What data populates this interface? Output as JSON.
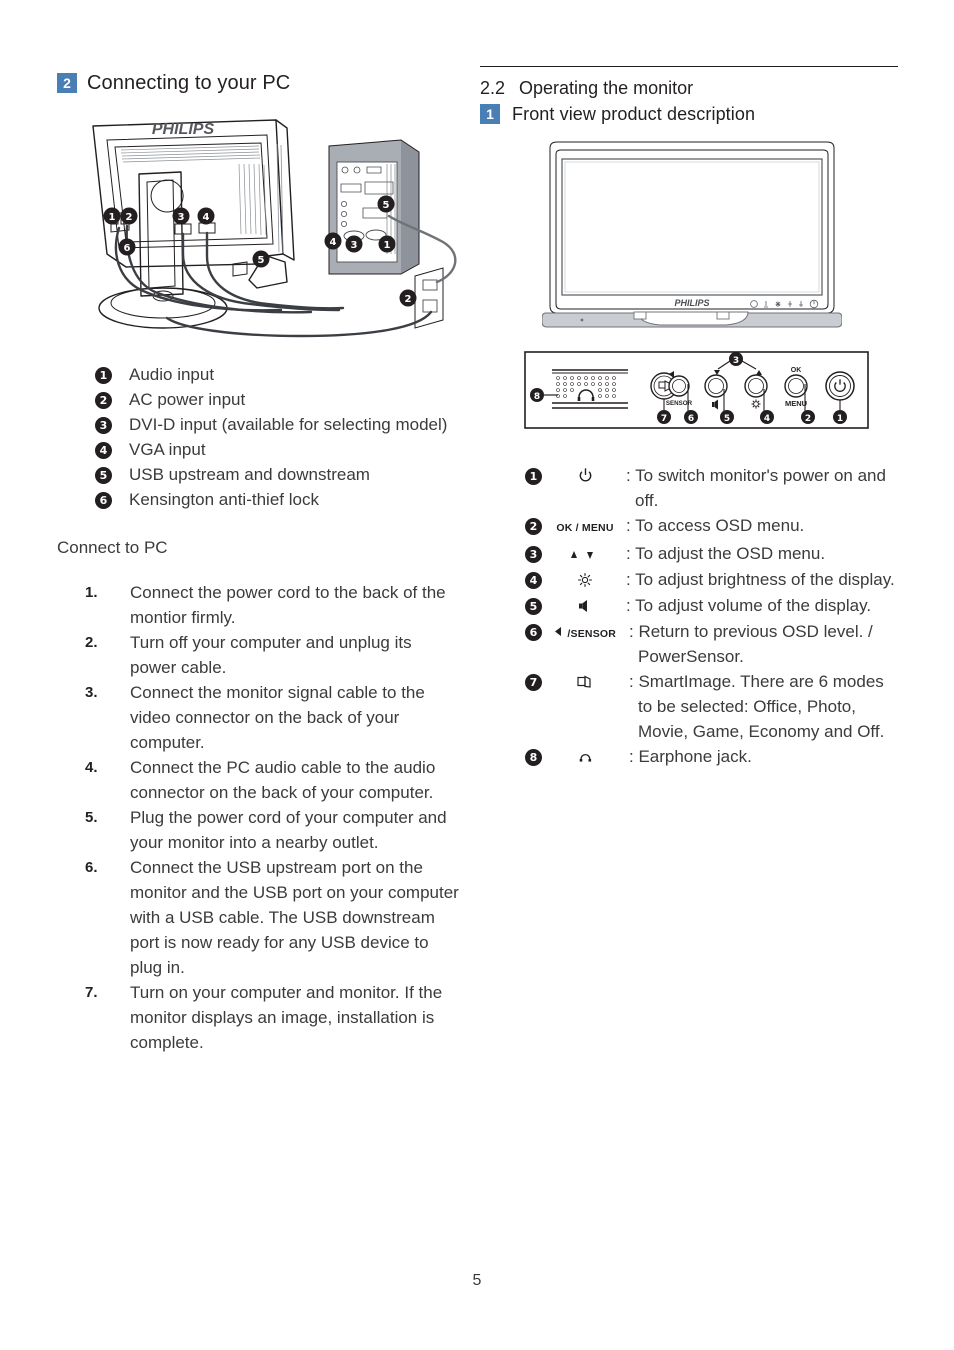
{
  "page_number": "5",
  "left_column": {
    "section_badge": "2",
    "section_title": "Connecting to your PC",
    "diagram": {
      "brand": "PHILIPS",
      "callouts": [
        "1",
        "2",
        "3",
        "4",
        "5",
        "6"
      ]
    },
    "legend": [
      {
        "num": "1",
        "label": "Audio input"
      },
      {
        "num": "2",
        "label": "AC power input"
      },
      {
        "num": "3",
        "label": "DVI-D input (available for selecting model)"
      },
      {
        "num": "4",
        "label": "VGA input"
      },
      {
        "num": "5",
        "label": "USB upstream and downstream"
      },
      {
        "num": "6",
        "label": "Kensington anti-thief lock"
      }
    ],
    "connect_title": "Connect to PC",
    "steps": [
      {
        "num": "1.",
        "text": "Connect the power cord to the back of the montior firmly."
      },
      {
        "num": "2.",
        "text": "Turn off your computer and unplug its power cable."
      },
      {
        "num": "3.",
        "text": "Connect the monitor signal cable to the video connector on the back of your computer."
      },
      {
        "num": "4.",
        "text": "Connect the PC audio cable to the audio connector on the back of your computer."
      },
      {
        "num": "5.",
        "text": "Plug the power cord of your computer and your monitor into a nearby outlet."
      },
      {
        "num": "6.",
        "text": "Connect the USB upstream port on the monitor and the USB port on your computer with a USB cable. The USB downstream port is now ready for any USB device to plug in."
      },
      {
        "num": "7.",
        "text": "Turn on your computer and monitor. If the monitor displays an image, installation is complete."
      }
    ]
  },
  "right_column": {
    "section_number": "2.2",
    "section_title": "Operating the monitor",
    "sub_badge": "1",
    "sub_title": "Front view product description",
    "monitor_figure": {
      "brand": "PHILIPS"
    },
    "control_panel": {
      "labels": {
        "ok": "OK",
        "menu": "MENU",
        "sensor": "SENSOR"
      },
      "callouts": [
        "1",
        "2",
        "3",
        "4",
        "5",
        "6",
        "7",
        "8"
      ]
    },
    "buttons": [
      {
        "num": "1",
        "icon": "power-icon",
        "icon_text": "",
        "desc": ": To switch monitor's power on and",
        "desc2": "off."
      },
      {
        "num": "2",
        "icon": "ok-menu-text",
        "icon_text": "OK / MENU",
        "desc": ": To access OSD menu.",
        "desc2": ""
      },
      {
        "num": "3",
        "icon": "up-down-arrows-icon",
        "icon_text": "",
        "desc": ": To adjust the OSD menu.",
        "desc2": ""
      },
      {
        "num": "4",
        "icon": "brightness-icon",
        "icon_text": "",
        "desc": ": To adjust brightness of the display.",
        "desc2": ""
      },
      {
        "num": "5",
        "icon": "volume-icon",
        "icon_text": "",
        "desc": ": To adjust volume of the display.",
        "desc2": ""
      },
      {
        "num": "6",
        "icon": "back-sensor-icon",
        "icon_text": "/SENSOR",
        "desc": ": Return to previous OSD level. /",
        "desc2": "PowerSensor."
      },
      {
        "num": "7",
        "icon": "smartimage-icon",
        "icon_text": "",
        "desc": ": SmartImage. There are 6 modes",
        "desc2": "to be selected: Office, Photo, Movie, Game, Economy and Off."
      },
      {
        "num": "8",
        "icon": "earphone-icon",
        "icon_text": "",
        "desc": ": Earphone jack.",
        "desc2": ""
      }
    ]
  },
  "colors": {
    "accent_blue": "#4a7fb5",
    "text": "#3b3b3d",
    "heading": "#231f20"
  }
}
